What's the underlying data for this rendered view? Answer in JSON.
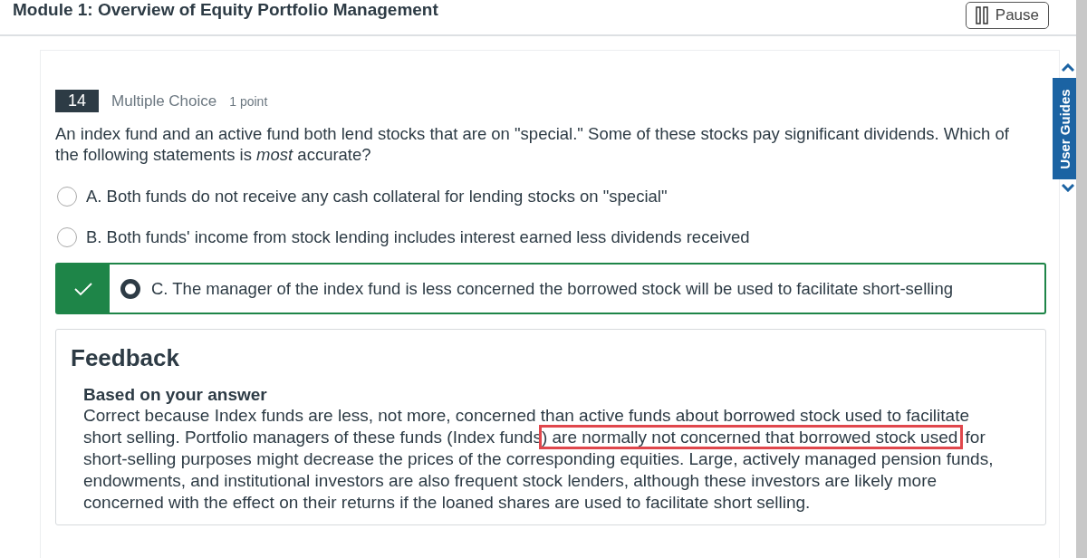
{
  "header": {
    "title": "Module 1: Overview of Equity Portfolio Management",
    "pause_button": "Pause"
  },
  "side_tab": {
    "label": "User Guides"
  },
  "question": {
    "number": "14",
    "type": "Multiple Choice",
    "points": "1 point",
    "text": "An index fund and an active fund both lend stocks that are on \"special.\" Some of these stocks pay significant dividends. Which of the following statements is *most* accurate?"
  },
  "options": [
    {
      "label": "A. Both funds do not receive any cash collateral for lending stocks on \"special\"",
      "selected": false
    },
    {
      "label": "B. Both funds' income from stock lending includes interest earned less dividends received",
      "selected": false
    },
    {
      "label": "C. The manager of the index fund is less concerned the borrowed stock will be used to facilitate short-selling",
      "selected": true
    }
  ],
  "answer_correct": true,
  "feedback": {
    "title": "Feedback",
    "subtitle": "Based on your answer",
    "body_before": "Correct because Index funds are less, not more, concerned than active funds about borrowed stock used to facilitate short selling. Portfolio managers of these funds (Index funds",
    "body_highlighted": ") are normally not concerned that borrowed stock used",
    "body_after": " for short-selling purposes might decrease the prices of the corresponding equities. Large, actively managed pension funds, endowments, and institutional investors are also frequent stock lenders, although these investors are likely more concerned with the effect on their returns if the loaned shares are used to facilitate short selling."
  }
}
